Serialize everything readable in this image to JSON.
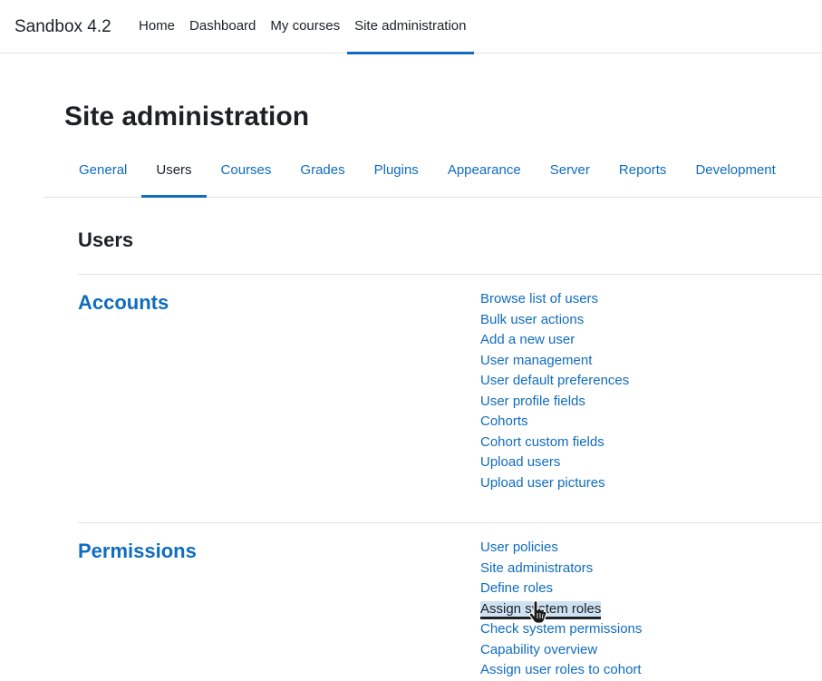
{
  "navbar": {
    "brand": "Sandbox 4.2",
    "items": [
      {
        "label": "Home",
        "active": false
      },
      {
        "label": "Dashboard",
        "active": false
      },
      {
        "label": "My courses",
        "active": false
      },
      {
        "label": "Site administration",
        "active": true
      }
    ]
  },
  "page": {
    "title": "Site administration"
  },
  "tabs": [
    {
      "label": "General",
      "active": false
    },
    {
      "label": "Users",
      "active": true
    },
    {
      "label": "Courses",
      "active": false
    },
    {
      "label": "Grades",
      "active": false
    },
    {
      "label": "Plugins",
      "active": false
    },
    {
      "label": "Appearance",
      "active": false
    },
    {
      "label": "Server",
      "active": false
    },
    {
      "label": "Reports",
      "active": false
    },
    {
      "label": "Development",
      "active": false
    }
  ],
  "section": {
    "heading": "Users"
  },
  "groups": [
    {
      "title": "Accounts",
      "links": [
        "Browse list of users",
        "Bulk user actions",
        "Add a new user",
        "User management",
        "User default preferences",
        "User profile fields",
        "Cohorts",
        "Cohort custom fields",
        "Upload users",
        "Upload user pictures"
      ]
    },
    {
      "title": "Permissions",
      "links": [
        "User policies",
        "Site administrators",
        "Define roles",
        "Assign system roles",
        "Check system permissions",
        "Capability overview",
        "Assign user roles to cohort"
      ],
      "hovered_link": "Assign system roles"
    }
  ],
  "icons": {
    "pointer": "hand-pointer-cursor-icon"
  },
  "colors": {
    "link": "#0f6cbf",
    "text": "#1d2125",
    "hover_bg": "#cfe2f3",
    "border": "#dee2e6"
  }
}
